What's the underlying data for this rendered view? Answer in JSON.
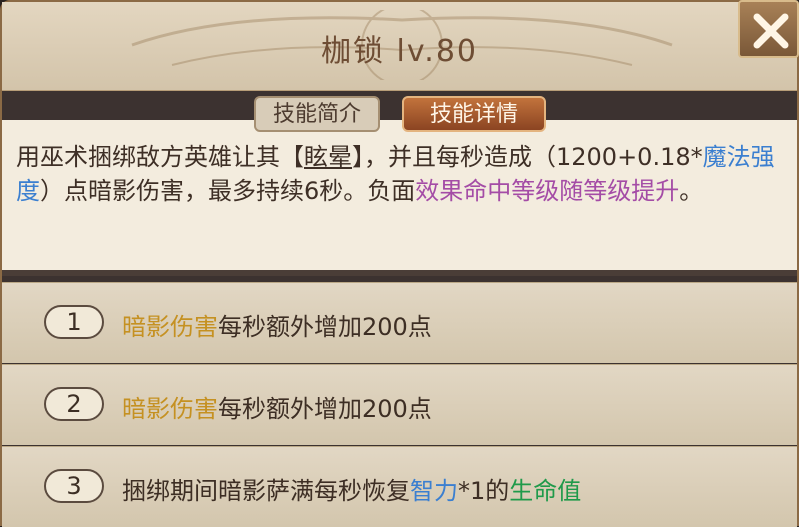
{
  "header": {
    "title": "枷锁 lv.80"
  },
  "tabs": {
    "intro": "技能简介",
    "detail": "技能详情"
  },
  "description": {
    "p1": "用巫术捆绑敌方英雄让其【",
    "stun": "眩晕",
    "p2": "】，并且每秒造成（1200+0.18*",
    "magic": "魔法强度",
    "p3": "）点暗影伤害，最多持续6秒。负面",
    "effect": "效果命中等级随等级提升",
    "p4": "。"
  },
  "upgrades": [
    {
      "num": "1",
      "hl": "暗影伤害",
      "rest": "每秒额外增加200点"
    },
    {
      "num": "2",
      "hl": "暗影伤害",
      "rest": "每秒额外增加200点"
    },
    {
      "num": "3",
      "pre": "捆绑期间暗影萨满每秒恢复",
      "stat": "智力",
      "mid": "*1的",
      "life": "生命值"
    }
  ],
  "colors": {
    "gold": "#c59122",
    "blue": "#3b7fd0",
    "purple": "#a44ca6",
    "green": "#1f9a4a"
  }
}
